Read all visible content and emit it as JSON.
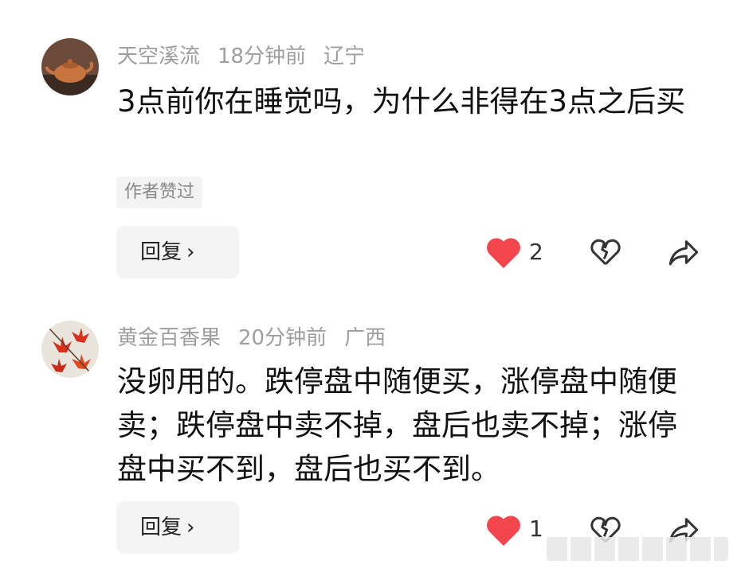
{
  "comments": [
    {
      "username": "天空溪流",
      "time": "18分钟前",
      "location": "辽宁",
      "text": "3点前你在睡觉吗，为什么非得在3点之后买",
      "tag": "作者赞过",
      "reply_label": "回复",
      "like_count": "2",
      "avatar_icon": "teapot-avatar"
    },
    {
      "username": "黄金百香果",
      "time": "20分钟前",
      "location": "广西",
      "text": "没卵用的。跌停盘中随便买，涨停盘中随便卖；跌停盘中卖不掉，盘后也卖不掉；涨停盘中买不到，盘后也买不到。",
      "reply_label": "回复",
      "like_count": "1",
      "avatar_icon": "maple-leaf-avatar"
    }
  ],
  "colors": {
    "like": "#f2454c",
    "meta": "#9e9e9e",
    "text": "#111111"
  }
}
